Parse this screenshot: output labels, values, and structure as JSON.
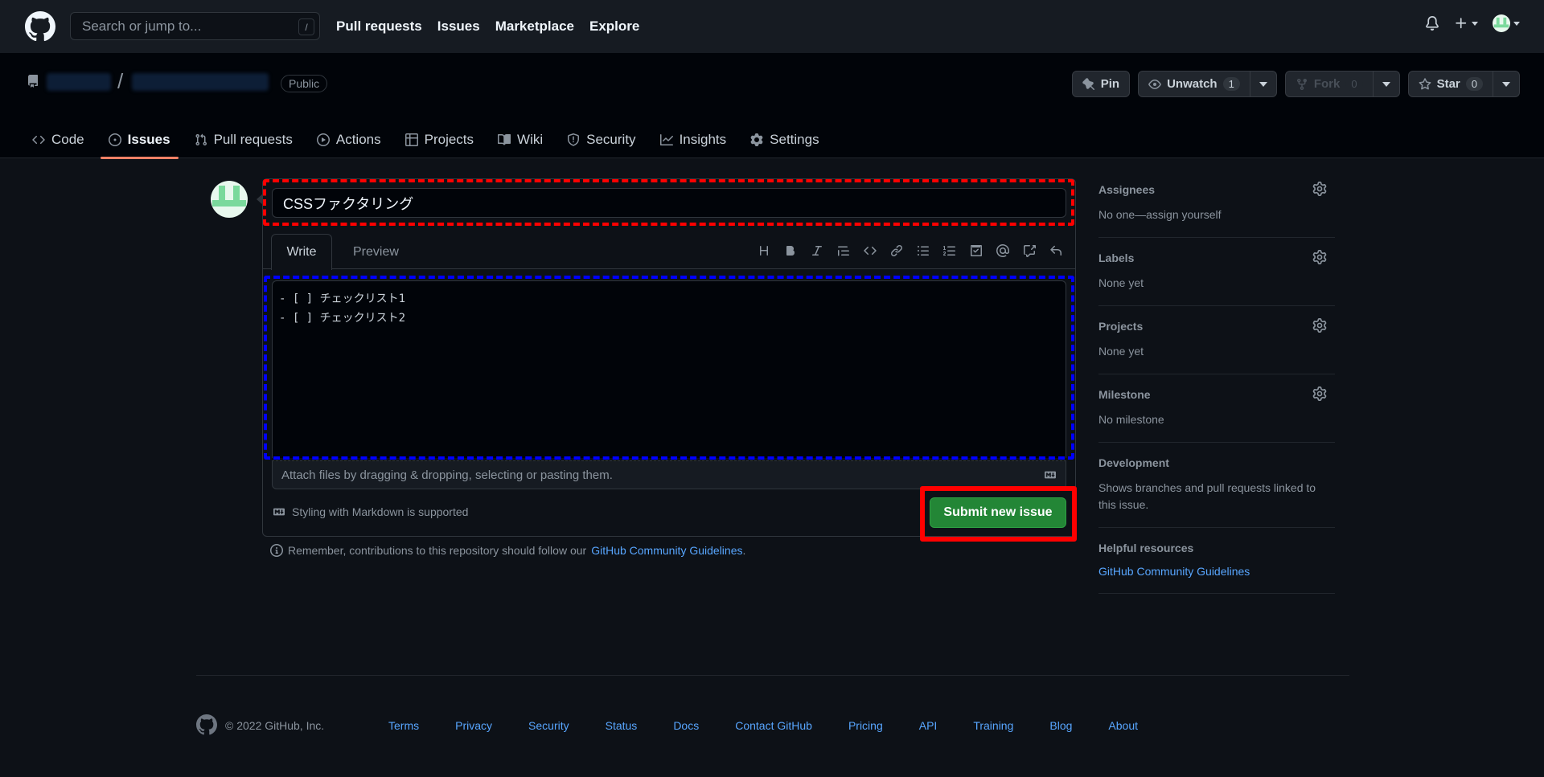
{
  "header": {
    "search_placeholder": "Search or jump to...",
    "search_shortcut": "/",
    "nav": [
      "Pull requests",
      "Issues",
      "Marketplace",
      "Explore"
    ]
  },
  "repo": {
    "separator": "/",
    "visibility": "Public",
    "pin_label": "Pin",
    "unwatch_label": "Unwatch",
    "watch_count": "1",
    "fork_label": "Fork",
    "fork_count": "0",
    "star_label": "Star",
    "star_count": "0",
    "tabs": [
      {
        "label": "Code",
        "icon": "code-icon"
      },
      {
        "label": "Issues",
        "icon": "issue-icon"
      },
      {
        "label": "Pull requests",
        "icon": "pull-request-icon"
      },
      {
        "label": "Actions",
        "icon": "play-icon"
      },
      {
        "label": "Projects",
        "icon": "table-icon"
      },
      {
        "label": "Wiki",
        "icon": "book-icon"
      },
      {
        "label": "Security",
        "icon": "shield-icon"
      },
      {
        "label": "Insights",
        "icon": "graph-icon"
      },
      {
        "label": "Settings",
        "icon": "gear-icon"
      }
    ],
    "selected_tab": "Issues"
  },
  "issue_form": {
    "title_value": "CSSファクタリング",
    "tab_write": "Write",
    "tab_preview": "Preview",
    "body_lines": [
      "- [ ] チェックリスト1",
      "- [ ] チェックリスト2"
    ],
    "attach_text": "Attach files by dragging & dropping, selecting or pasting them.",
    "markdown_note": "Styling with Markdown is supported",
    "submit_label": "Submit new issue",
    "remember_text": "Remember, contributions to this repository should follow our",
    "remember_link": "GitHub Community Guidelines",
    "remember_end": "."
  },
  "sidebar": {
    "assignees_title": "Assignees",
    "assignees_value": "No one—assign yourself",
    "labels_title": "Labels",
    "labels_value": "None yet",
    "projects_title": "Projects",
    "projects_value": "None yet",
    "milestone_title": "Milestone",
    "milestone_value": "No milestone",
    "development_title": "Development",
    "development_value": "Shows branches and pull requests linked to this issue.",
    "helpful_title": "Helpful resources",
    "helpful_link": "GitHub Community Guidelines"
  },
  "footer": {
    "copyright": "© 2022 GitHub, Inc.",
    "links": [
      "Terms",
      "Privacy",
      "Security",
      "Status",
      "Docs",
      "Contact GitHub",
      "Pricing",
      "API",
      "Training",
      "Blog",
      "About"
    ]
  },
  "colors": {
    "accent_green": "#238636",
    "link_blue": "#58a6ff",
    "tab_underline": "#f78166",
    "highlight_red": "#ff0000",
    "highlight_blue": "#0000ff"
  }
}
